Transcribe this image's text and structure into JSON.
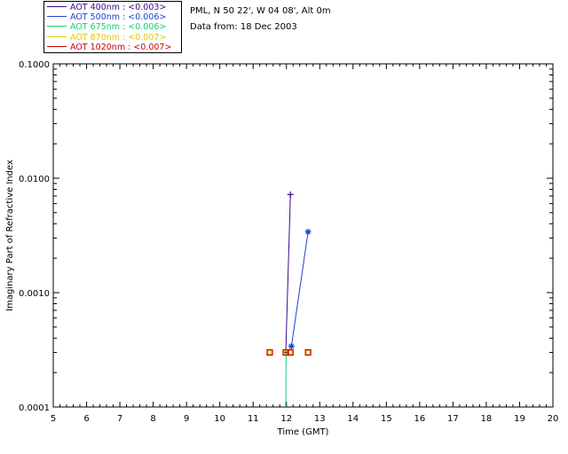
{
  "info": {
    "location": "PML, N 50 22', W 04 08', Alt 0m",
    "date": "Data from: 18 Dec 2003"
  },
  "legend": [
    {
      "label": "AOT  400nm : <0.003>",
      "color": "#3a0a8c"
    },
    {
      "label": "AOT  500nm : <0.006>",
      "color": "#1f3fd6"
    },
    {
      "label": "AOT  675nm : <0.006>",
      "color": "#10d07a"
    },
    {
      "label": "AOT  870nm : <0.007>",
      "color": "#e6c800"
    },
    {
      "label": "AOT 1020nm : <0.007>",
      "color": "#cc0000"
    }
  ],
  "chart_data": {
    "type": "line",
    "xlabel": "Time (GMT)",
    "ylabel": "Imaginary Part of Refractive Index",
    "xlim": [
      5,
      20
    ],
    "ylim": [
      0.0001,
      0.1
    ],
    "yscale": "log",
    "x_ticks": [
      "5",
      "6",
      "7",
      "8",
      "9",
      "10",
      "11",
      "12",
      "13",
      "14",
      "15",
      "16",
      "17",
      "18",
      "19",
      "20"
    ],
    "y_ticks": [
      "0.0001",
      "0.0010",
      "0.0100",
      "0.1000"
    ],
    "series": [
      {
        "name": "AOT  400nm : <0.003>",
        "color": "#3a0a8c",
        "marker": "plus",
        "x": [
          11.98,
          12.12
        ],
        "y": [
          0.0003,
          0.0072
        ]
      },
      {
        "name": "AOT  500nm : <0.006>",
        "color": "#1f3fd6",
        "marker": "asterisk",
        "x": [
          12.15,
          12.65
        ],
        "y": [
          0.00034,
          0.0034
        ]
      },
      {
        "name": "AOT  675nm : <0.006>",
        "color": "#10d07a",
        "marker": "none",
        "x": [
          11.98,
          11.99
        ],
        "y": [
          0.0001,
          0.0003
        ]
      },
      {
        "name": "AOT  870nm : <0.007>",
        "color": "#e6c800",
        "marker": "square",
        "x": [
          11.5,
          11.98,
          12.12,
          12.65
        ],
        "y": [
          0.0003,
          0.0003,
          0.0003,
          0.0003
        ]
      },
      {
        "name": "AOT 1020nm : <0.007>",
        "color": "#cc0000",
        "marker": "square",
        "x": [
          11.5,
          11.98,
          12.12,
          12.65
        ],
        "y": [
          0.0003,
          0.0003,
          0.0003,
          0.0003
        ]
      }
    ]
  }
}
